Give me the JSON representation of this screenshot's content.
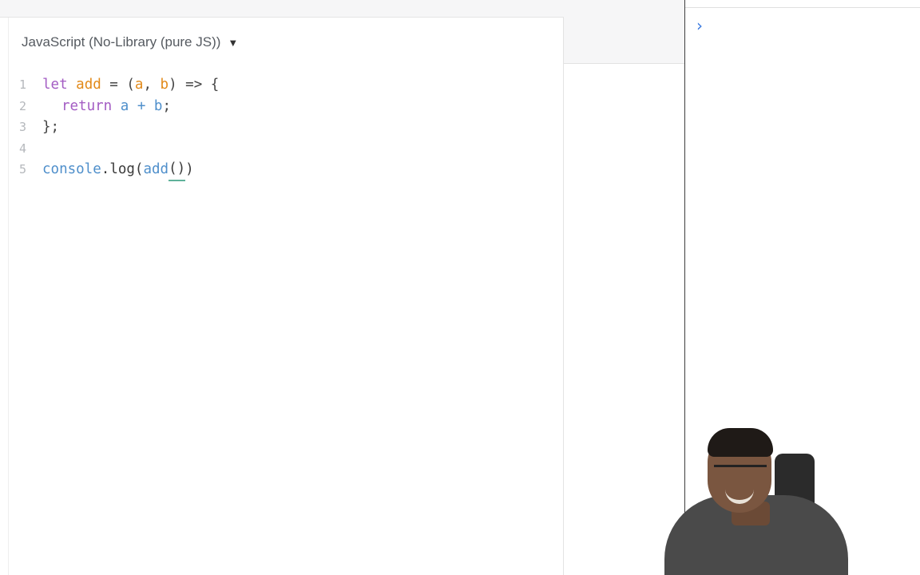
{
  "editor": {
    "language_label": "JavaScript (No-Library (pure JS))",
    "language_arrow": "▼",
    "line_numbers": [
      "1",
      "2",
      "3",
      "4",
      "5"
    ],
    "code": {
      "l1_kw": "let",
      "l1_fn": "add",
      "l1_eq": " = (",
      "l1_a": "a",
      "l1_comma": ", ",
      "l1_b": "b",
      "l1_arrow": ") => {",
      "l2_kw": "return",
      "l2_expr": " a + b",
      "l2_semi": ";",
      "l3": "};",
      "l5_console": "console",
      "l5_dot": ".",
      "l5_log": "log",
      "l5_open": "(",
      "l5_add": "add",
      "l5_parens": "()",
      "l5_close": ")"
    }
  },
  "console": {
    "prompt_icon": "chevron-right-icon",
    "prompt_glyph": "›"
  },
  "colors": {
    "keyword": "#a35cc3",
    "function_name": "#e28a1a",
    "identifier": "#4f8fcb",
    "prompt": "#3b7ae0"
  }
}
